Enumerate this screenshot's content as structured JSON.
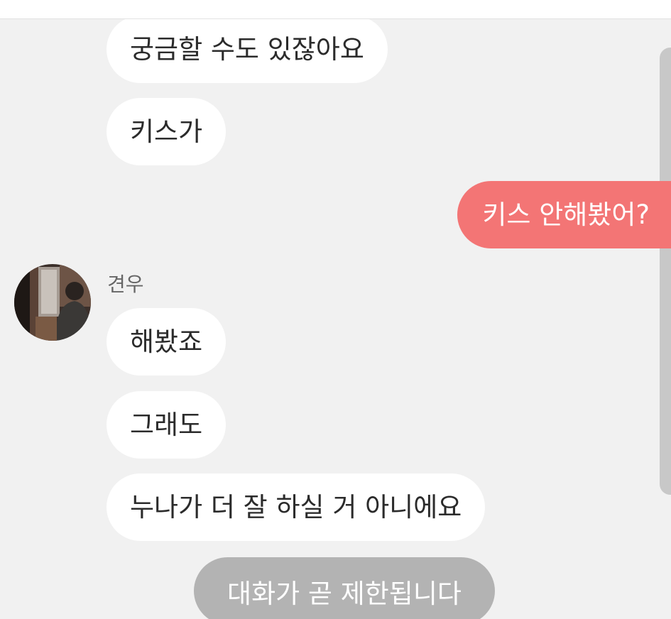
{
  "messages": [
    {
      "id": "m1",
      "text": "궁금할 수도 있잖아요"
    },
    {
      "id": "m2",
      "text": "키스가"
    },
    {
      "id": "m3",
      "text": "키스 안해봤어?"
    },
    {
      "id": "m4",
      "text": "해봤죠"
    },
    {
      "id": "m5",
      "text": "그래도"
    },
    {
      "id": "m6",
      "text": "누나가 더 잘 하실 거 아니에요"
    }
  ],
  "sender": {
    "name": "견우"
  },
  "system": {
    "notice": "대화가 곧 제한됩니다"
  },
  "colors": {
    "background": "#f1f1f1",
    "incoming_bubble": "#ffffff",
    "outgoing_bubble": "#f37575",
    "system_pill": "#b3b3b3"
  }
}
